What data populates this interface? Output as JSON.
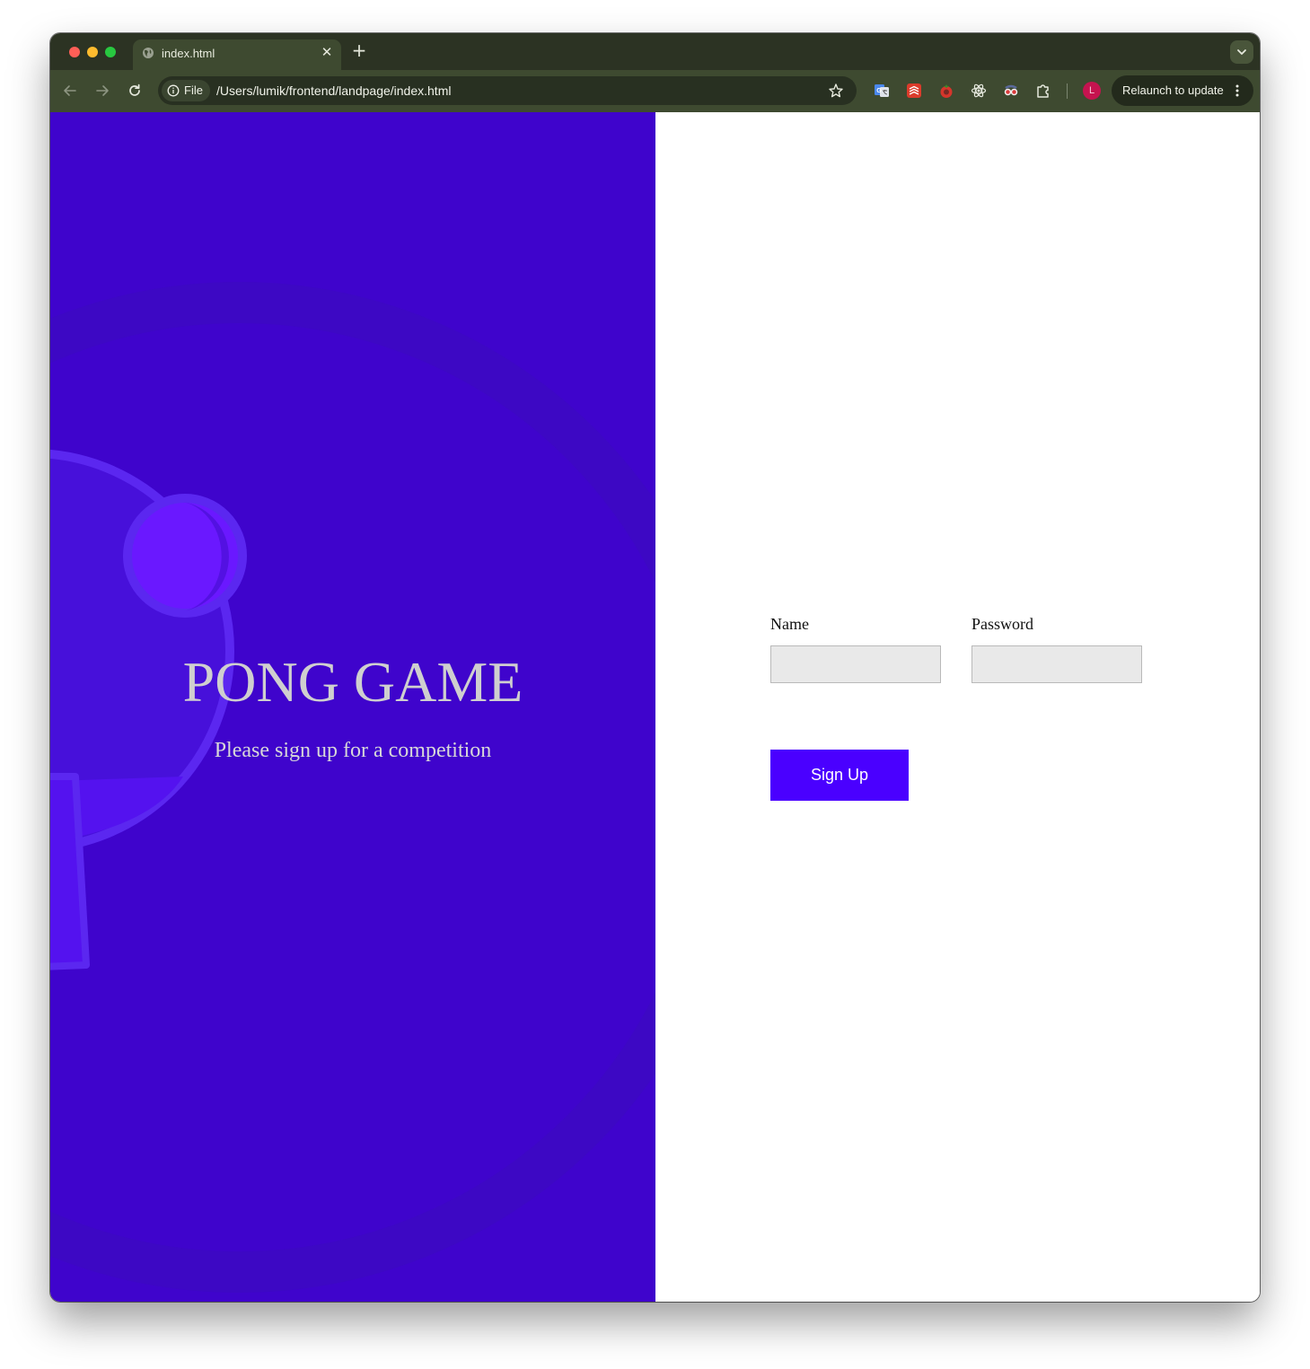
{
  "browser": {
    "tab": {
      "title": "index.html",
      "close_icon": "close-icon"
    },
    "new_tab_label": "+",
    "toolbar": {
      "back_icon": "arrow-left-icon",
      "forward_icon": "arrow-right-icon",
      "reload_icon": "reload-icon",
      "site_info_label": "File",
      "url": "/Users/lumik/frontend/landpage/index.html",
      "bookmark_icon": "star-icon",
      "extensions": [
        "google-translate-icon",
        "todoist-icon",
        "tomato-timer-icon",
        "react-devtools-icon",
        "spy-glasses-icon",
        "puzzle-piece-icon"
      ],
      "profile_initial": "L",
      "relaunch_label": "Relaunch to update"
    }
  },
  "hero": {
    "title": "PONG GAME",
    "subtitle": "Please sign up for a competition"
  },
  "form": {
    "name_label": "Name",
    "name_value": "",
    "password_label": "Password",
    "password_value": "",
    "submit_label": "Sign Up"
  },
  "colors": {
    "hero_background": "#3f04cc",
    "button": "#4a00ff",
    "tabstrip": "#2c3323",
    "toolbar": "#3e4a30"
  }
}
